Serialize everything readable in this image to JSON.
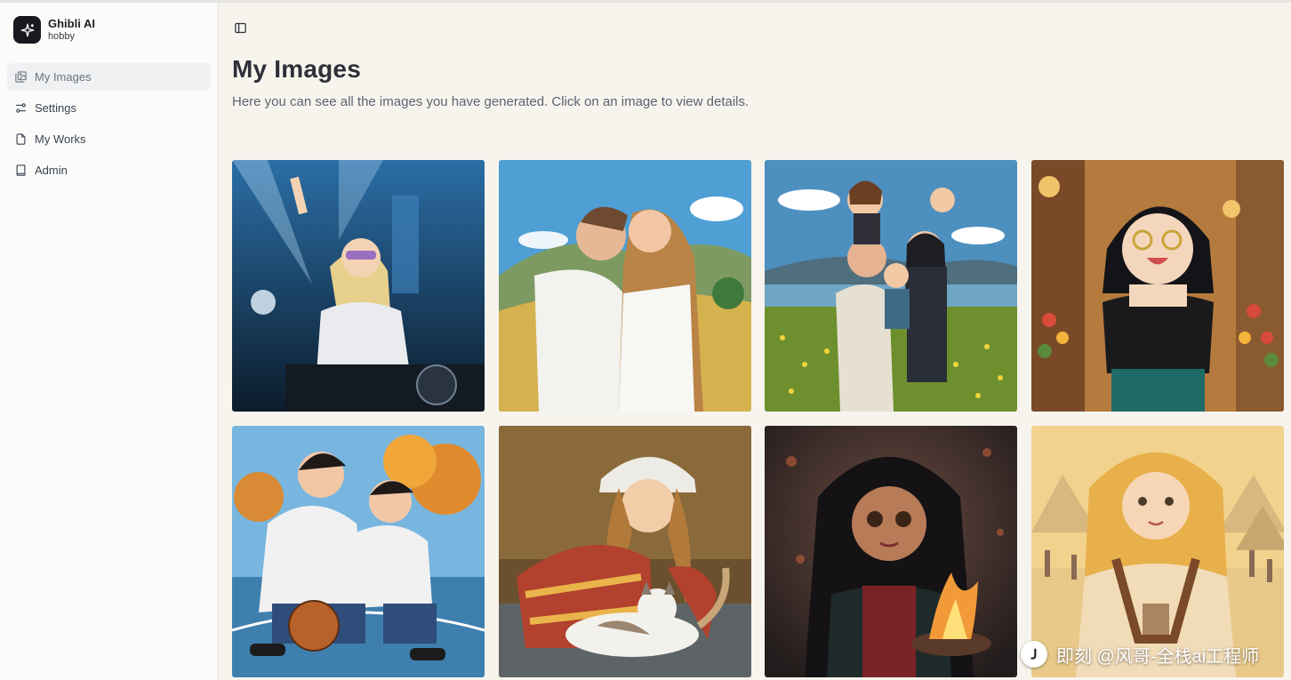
{
  "app": {
    "name": "Ghibli AI",
    "plan": "hobby"
  },
  "sidebar": {
    "items": [
      {
        "label": "My Images",
        "icon": "images-icon",
        "active": true
      },
      {
        "label": "Settings",
        "icon": "sliders-icon",
        "active": false
      },
      {
        "label": "My Works",
        "icon": "file-icon",
        "active": false
      },
      {
        "label": "Admin",
        "icon": "book-icon",
        "active": false
      }
    ]
  },
  "main": {
    "title": "My Images",
    "subtitle": "Here you can see all the images you have generated. Click on an image to view details."
  },
  "images": [
    {
      "subject": "DJ with sunglasses at turntables",
      "bg": "#173a5c"
    },
    {
      "subject": "Couple embracing on hillside",
      "bg": "#6aa6cc"
    },
    {
      "subject": "Family portrait in flower field",
      "bg": "#5a98c4"
    },
    {
      "subject": "Girl with glasses at market",
      "bg": "#c58a4a"
    },
    {
      "subject": "Two boys with basketball",
      "bg": "#d99a3e"
    },
    {
      "subject": "Girl in beanie petting cat",
      "bg": "#7a5a34"
    },
    {
      "subject": "Girl with fire bowl",
      "bg": "#3a3030"
    },
    {
      "subject": "Girl at desert tent market",
      "bg": "#e8c07a"
    }
  ],
  "watermark": {
    "text": "即刻 @风哥-全栈ai工程师"
  },
  "colors": {
    "sidebar_bg": "#fbfbfa",
    "main_bg": "#f7f4ee",
    "active_item_bg": "#f0f1f2",
    "logo_bg": "#17191f"
  }
}
